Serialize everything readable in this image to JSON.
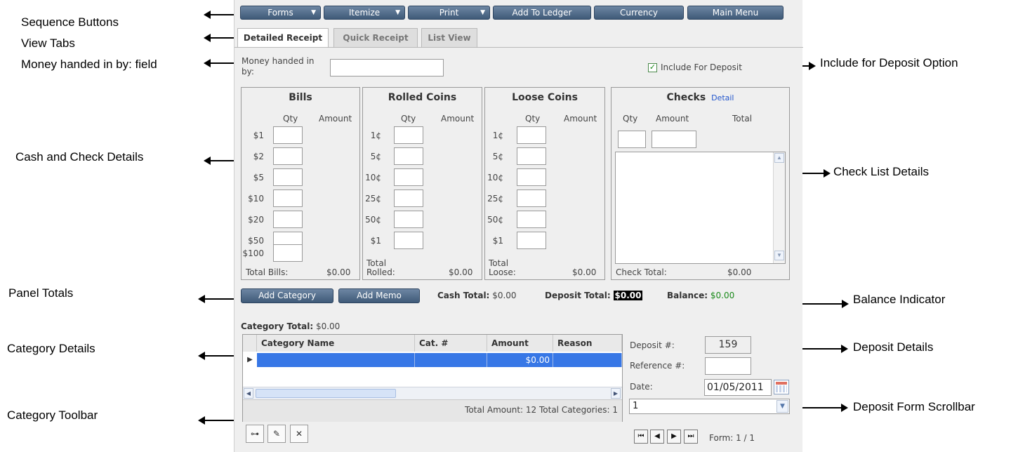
{
  "annotations": {
    "sequence_buttons": "Sequence Buttons",
    "view_tabs": "View Tabs",
    "money_field": "Money handed in by: field",
    "include_option": "Include for Deposit Option",
    "cash_check_details": "Cash and Check Details",
    "check_list_details": "Check List Details",
    "panel_totals": "Panel Totals",
    "balance_indicator": "Balance Indicator",
    "category_details": "Category Details",
    "deposit_details": "Deposit Details",
    "category_toolbar": "Category Toolbar",
    "deposit_form_scrollbar": "Deposit Form Scrollbar"
  },
  "toolbar": {
    "forms": "Forms",
    "itemize": "Itemize",
    "print": "Print",
    "add_to_ledger": "Add To Ledger",
    "currency": "Currency",
    "main_menu": "Main Menu"
  },
  "tabs": [
    "Detailed Receipt",
    "Quick Receipt",
    "List View"
  ],
  "money_label": "Money handed in by:",
  "money_value": "",
  "include_deposit_label": "Include For Deposit",
  "include_deposit_checked": true,
  "bills": {
    "title": "Bills",
    "col_qty": "Qty",
    "col_amount": "Amount",
    "denoms": [
      "$1",
      "$2",
      "$5",
      "$10",
      "$20",
      "$50",
      "$100"
    ],
    "total_label": "Total Bills:",
    "total_value": "$0.00"
  },
  "rolled": {
    "title": "Rolled Coins",
    "col_qty": "Qty",
    "col_amount": "Amount",
    "denoms": [
      "1¢",
      "5¢",
      "10¢",
      "25¢",
      "50¢",
      "$1"
    ],
    "total_label_1": "Total",
    "total_label_2": "Rolled:",
    "total_value": "$0.00"
  },
  "loose": {
    "title": "Loose Coins",
    "col_qty": "Qty",
    "col_amount": "Amount",
    "denoms": [
      "1¢",
      "5¢",
      "10¢",
      "25¢",
      "50¢",
      "$1"
    ],
    "total_label_1": "Total",
    "total_label_2": "Loose:",
    "total_value": "$0.00"
  },
  "checks": {
    "title": "Checks",
    "detail_link": "Detail",
    "col_qty": "Qty",
    "col_amount": "Amount",
    "col_total": "Total",
    "total_label": "Check Total:",
    "total_value": "$0.00"
  },
  "actions": {
    "add_category": "Add Category",
    "add_memo": "Add Memo"
  },
  "totals": {
    "cash_label": "Cash Total:",
    "cash_value": "$0.00",
    "deposit_label": "Deposit Total:",
    "deposit_value": "$0.00",
    "balance_label": "Balance:",
    "balance_value": "$0.00",
    "balance_color": "#1a8a1a"
  },
  "category": {
    "total_label": "Category Total:",
    "total_value": "$0.00",
    "columns": [
      "Category Name",
      "Cat. #",
      "Amount",
      "Reason"
    ],
    "rows": [
      {
        "name": "",
        "num": "",
        "amount": "$0.00",
        "reason": ""
      }
    ],
    "footer": "Total Amount: 12 Total Categories: 1"
  },
  "deposit": {
    "deposit_label": "Deposit #:",
    "deposit_value": "159",
    "reference_label": "Reference #:",
    "reference_value": "",
    "date_label": "Date:",
    "date_value": "01/05/2011",
    "form_select": "1",
    "form_counter": "Form: 1 / 1"
  },
  "icons": {
    "toolbar": [
      "add-subcategory-icon",
      "edit-pencil-icon",
      "delete-category-icon"
    ],
    "nav": [
      "first-record-icon",
      "previous-record-icon",
      "next-record-icon",
      "last-record-icon"
    ]
  },
  "colors": {
    "button_dark": "#4a6583",
    "selected_row": "#3777e6",
    "detail_link": "#2255cc"
  }
}
